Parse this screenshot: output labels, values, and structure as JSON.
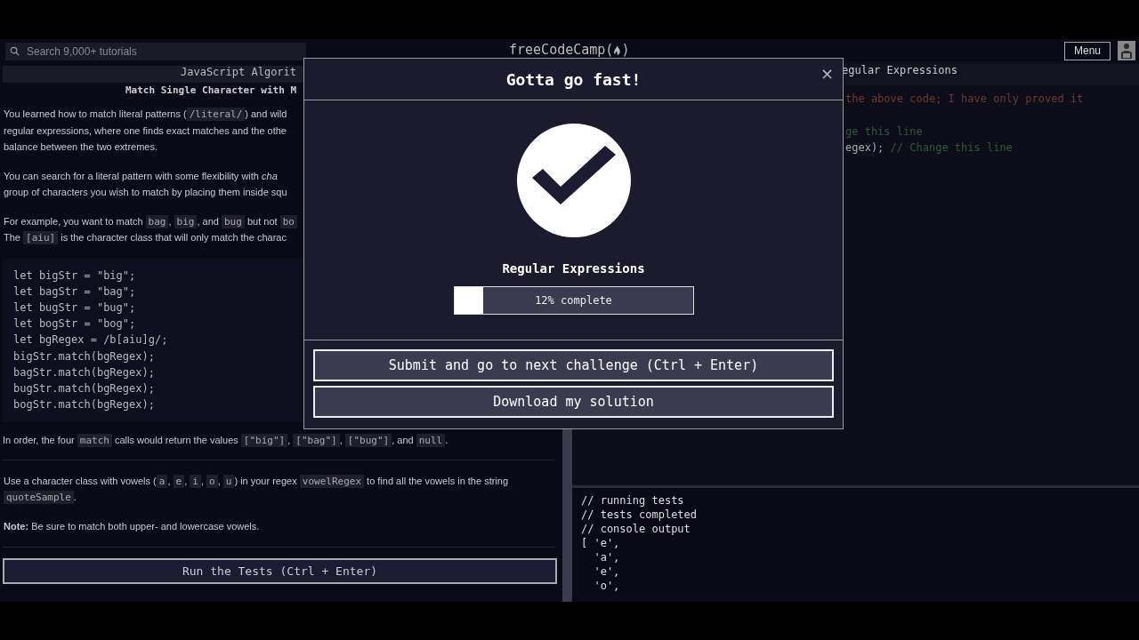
{
  "nav": {
    "search": {
      "placeholder": "Search 9,000+ tutorials"
    },
    "logo": {
      "before": "freeCodeCamp(",
      "after": ")"
    },
    "menu": "Menu"
  },
  "lesson": {
    "breadcrumb": "JavaScript Algorit",
    "title": "Match Single Character with M",
    "paragraphs": [
      [
        [
          {
            "t": "You learned how to match literal patterns ("
          },
          {
            "t": "/literal/",
            "code": true
          },
          {
            "t": ") and wild"
          }
        ],
        [
          {
            "t": "regular expressions, where one finds exact matches and the othe"
          }
        ],
        [
          {
            "t": "balance between the two extremes."
          }
        ]
      ],
      [
        [
          {
            "t": "You can search for a literal pattern with some flexibility with *cha*"
          }
        ],
        [
          {
            "t": "group of characters you wish to match by placing them inside squ"
          }
        ]
      ],
      [
        [
          {
            "t": "For example, you want to match "
          },
          {
            "t": "bag",
            "code": true
          },
          {
            "t": ", "
          },
          {
            "t": "big",
            "code": true
          },
          {
            "t": ", and "
          },
          {
            "t": "bug",
            "code": true
          },
          {
            "t": " but not "
          },
          {
            "t": "bo",
            "code": true
          }
        ],
        [
          {
            "t": "The "
          },
          {
            "t": "[aiu]",
            "code": true
          },
          {
            "t": " is the character class that will only match the charac"
          }
        ]
      ]
    ],
    "code": [
      "let bigStr = \"big\";",
      "let bagStr = \"bag\";",
      "let bugStr = \"bug\";",
      "let bogStr = \"bog\";",
      "let bgRegex = /b[aiu]g/;",
      "bigStr.match(bgRegex);",
      "bagStr.match(bgRegex);",
      "bugStr.match(bgRegex);",
      "bogStr.match(bgRegex);"
    ],
    "after_code": [
      [
        {
          "t": "In order, the four "
        },
        {
          "t": "match",
          "code": true
        },
        {
          "t": " calls would return the values "
        },
        {
          "t": "[\"big\"]",
          "code": true
        },
        {
          "t": ", "
        },
        {
          "t": "[\"bag\"]",
          "code": true
        },
        {
          "t": ", "
        },
        {
          "t": "[\"bug\"]",
          "code": true
        },
        {
          "t": ", and "
        },
        {
          "t": "null",
          "code": true
        },
        {
          "t": "."
        }
      ]
    ],
    "instructions": [
      [
        [
          {
            "t": "Use a character class with vowels ("
          },
          {
            "t": "a",
            "code": true
          },
          {
            "t": ", "
          },
          {
            "t": "e",
            "code": true
          },
          {
            "t": ", "
          },
          {
            "t": "i",
            "code": true
          },
          {
            "t": ", "
          },
          {
            "t": "o",
            "code": true
          },
          {
            "t": ", "
          },
          {
            "t": "u",
            "code": true
          },
          {
            "t": ") in your regex "
          },
          {
            "t": "vowelRegex",
            "code": true
          },
          {
            "t": " to find all the vowels in the string"
          }
        ],
        [
          {
            "t": "quoteSample",
            "code": true
          },
          {
            "t": "."
          }
        ]
      ],
      [
        [
          {
            "t": "**Note:** Be sure to match both upper- and lowercase vowels."
          }
        ]
      ]
    ],
    "run_button": "Run the Tests (Ctrl + Enter)"
  },
  "editor": {
    "breadcrumb": "egular Expressions",
    "lines": [
      {
        "block_comment": "the above code; I have only proved it"
      },
      {
        "comment": "ge this line"
      },
      {
        "code": "egex); ",
        "comment": "// Change this line"
      }
    ]
  },
  "console": [
    "// running tests",
    "// tests completed",
    "// console output",
    "[ 'e',",
    "  'a',",
    "  'e',",
    "  'o',"
  ],
  "modal": {
    "title": "Gotta go fast!",
    "close": "×",
    "section": "Regular Expressions",
    "progress": {
      "level": 0.12,
      "label": "12% complete"
    },
    "buttons": [
      "Submit and go to next challenge (Ctrl + Enter)",
      "Download my solution"
    ]
  }
}
